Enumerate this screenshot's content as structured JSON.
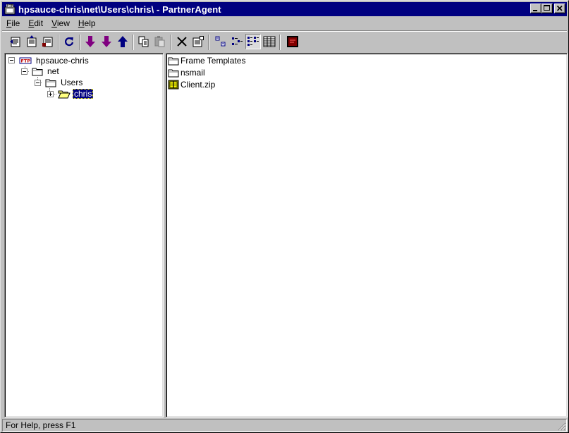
{
  "window": {
    "title": "hpsauce-chris\\net\\Users\\chris\\ - PartnerAgent",
    "buttons": [
      "minimize",
      "maximize",
      "close"
    ]
  },
  "menu": {
    "items": [
      {
        "label": "File",
        "accel": "F",
        "rest": "ile"
      },
      {
        "label": "Edit",
        "accel": "E",
        "rest": "dit"
      },
      {
        "label": "View",
        "accel": "V",
        "rest": "iew"
      },
      {
        "label": "Help",
        "accel": "H",
        "rest": "elp"
      }
    ]
  },
  "toolbar": {
    "buttons": [
      {
        "name": "connect-button",
        "icon": "connect-icon"
      },
      {
        "name": "disconnect-button",
        "icon": "disconnect-icon"
      },
      {
        "name": "properties-button",
        "icon": "properties-icon"
      },
      {
        "name": "refresh-button",
        "icon": "refresh-icon"
      },
      {
        "name": "download-button",
        "icon": "down-arrow-icon"
      },
      {
        "name": "download-all-button",
        "icon": "down-arrow-icon"
      },
      {
        "name": "upload-button",
        "icon": "up-arrow-icon"
      },
      {
        "name": "copy-button",
        "icon": "copy-icon"
      },
      {
        "name": "paste-button",
        "icon": "paste-icon"
      },
      {
        "name": "delete-button",
        "icon": "delete-icon"
      },
      {
        "name": "file-properties-button",
        "icon": "file-properties-icon"
      },
      {
        "name": "large-icons-view-button",
        "icon": "large-icons-icon"
      },
      {
        "name": "small-icons-view-button",
        "icon": "small-icons-icon"
      },
      {
        "name": "list-view-button",
        "icon": "list-icon",
        "pressed": true
      },
      {
        "name": "details-view-button",
        "icon": "details-icon"
      },
      {
        "name": "terminal-button",
        "icon": "terminal-icon"
      }
    ]
  },
  "tree": {
    "items": [
      {
        "label": "hpsauce-chris",
        "icon": "ftp-server-icon",
        "expanded": true,
        "level": 0
      },
      {
        "label": "net",
        "icon": "folder-icon",
        "expanded": true,
        "level": 1
      },
      {
        "label": "Users",
        "icon": "folder-icon",
        "expanded": true,
        "level": 2
      },
      {
        "label": "chris",
        "icon": "open-folder-icon",
        "expanded": false,
        "level": 3,
        "selected": true
      }
    ]
  },
  "list": {
    "items": [
      {
        "label": "Frame Templates",
        "icon": "folder-icon"
      },
      {
        "label": "nsmail",
        "icon": "folder-icon"
      },
      {
        "label": "Client.zip",
        "icon": "zip-file-icon"
      }
    ]
  },
  "status": {
    "text": "For Help, press F1"
  },
  "colors": {
    "title_bar": "#000080",
    "face": "#c0c0c0",
    "selection": "#000080"
  }
}
